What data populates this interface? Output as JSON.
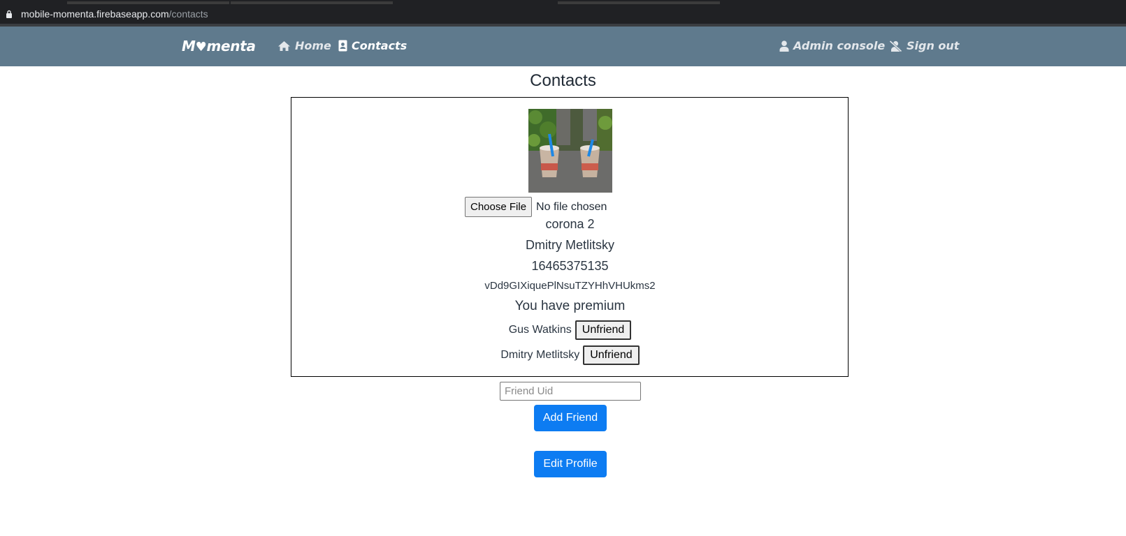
{
  "browser": {
    "url_host": "mobile-momenta.firebaseapp.com",
    "url_path": "/contacts"
  },
  "navbar": {
    "brand": {
      "prefix": "M",
      "heart": "♥",
      "suffix": "menta"
    },
    "home_label": "Home",
    "contacts_label": "Contacts",
    "admin_label": "Admin console",
    "signout_label": "Sign out"
  },
  "page": {
    "title": "Contacts"
  },
  "profile": {
    "file_button": "Choose File",
    "file_status": "No file chosen",
    "status_text": "corona 2",
    "name": "Dmitry Metlitsky",
    "phone": "16465375135",
    "uid": "vDd9GIXiquePlNsuTZYHhVHUkms2",
    "premium_text": "You have premium"
  },
  "friends": [
    {
      "name": "Gus Watkins",
      "action": "Unfriend"
    },
    {
      "name": "Dmitry Metlitsky",
      "action": "Unfriend"
    }
  ],
  "add_friend": {
    "placeholder": "Friend Uid",
    "button": "Add Friend"
  },
  "edit_profile": {
    "button": "Edit Profile"
  },
  "colors": {
    "navbar": "#5f7a8d",
    "primary": "#0d7cf2",
    "text": "#2b3642"
  },
  "icons": [
    "lock-icon",
    "home-icon",
    "contact-card-icon",
    "user-icon",
    "user-slash-icon",
    "heart-icon"
  ]
}
